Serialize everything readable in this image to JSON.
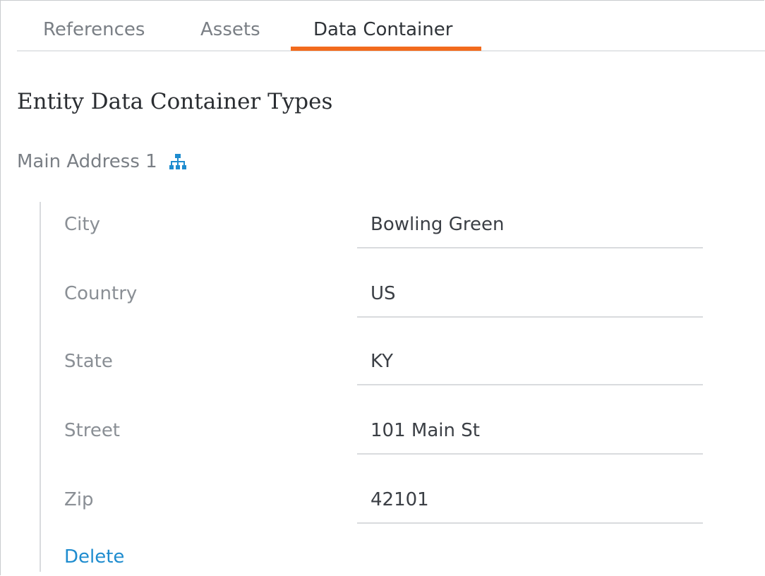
{
  "tabs": [
    {
      "label": "References"
    },
    {
      "label": "Assets"
    },
    {
      "label": "Data Container"
    }
  ],
  "active_tab": "Data Container",
  "accent_color": "#f26b1d",
  "link_color": "#1e8ccf",
  "section": {
    "title": "Entity Data Container Types"
  },
  "group": {
    "label": "Main Address 1",
    "icon": "hierarchy-icon",
    "fields": [
      {
        "label": "City",
        "value": "Bowling Green"
      },
      {
        "label": "Country",
        "value": "US"
      },
      {
        "label": "State",
        "value": "KY"
      },
      {
        "label": "Street",
        "value": "101 Main St"
      },
      {
        "label": "Zip",
        "value": "42101"
      }
    ],
    "delete_label": "Delete"
  }
}
